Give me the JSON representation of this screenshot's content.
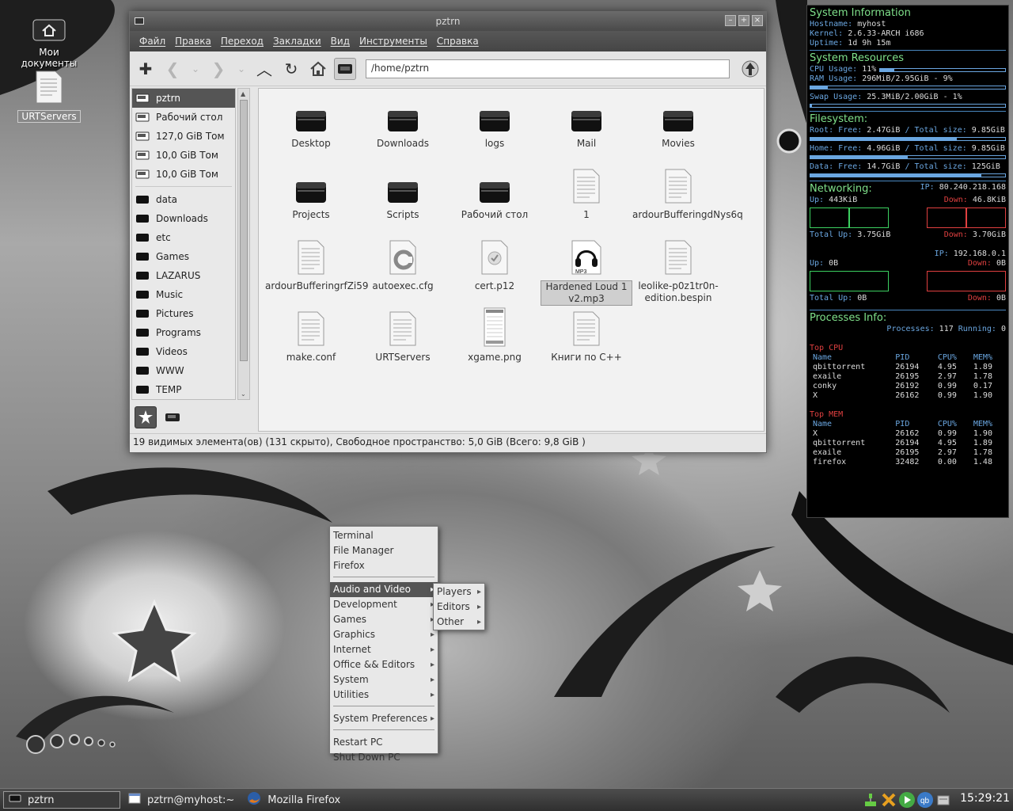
{
  "desktop": {
    "icons": [
      {
        "label": "Мои документы"
      },
      {
        "label": "URTServers"
      }
    ]
  },
  "window": {
    "title": "pztrn",
    "menu": [
      "Файл",
      "Правка",
      "Переход",
      "Закладки",
      "Вид",
      "Инструменты",
      "Справка"
    ],
    "path": "/home/pztrn",
    "sidebar": {
      "devices": [
        "pztrn",
        "Рабочий стол",
        "127,0 GiB Том",
        "10,0 GiB Том",
        "10,0 GiB Том"
      ],
      "bookmarks": [
        "data",
        "Downloads",
        "etc",
        "Games",
        "LAZARUS",
        "Music",
        "Pictures",
        "Programs",
        "Videos",
        "WWW",
        "TEMP"
      ]
    },
    "files": [
      {
        "name": "Desktop",
        "kind": "folder"
      },
      {
        "name": "Downloads",
        "kind": "folder"
      },
      {
        "name": "logs",
        "kind": "folder"
      },
      {
        "name": "Mail",
        "kind": "folder"
      },
      {
        "name": "Movies",
        "kind": "folder"
      },
      {
        "name": "Projects",
        "kind": "folder"
      },
      {
        "name": "Scripts",
        "kind": "folder"
      },
      {
        "name": "Рабочий стол",
        "kind": "folder"
      },
      {
        "name": "1",
        "kind": "doc"
      },
      {
        "name": "ardourBufferingdNys6q",
        "kind": "doc"
      },
      {
        "name": "ardourBufferingrfZi59",
        "kind": "doc"
      },
      {
        "name": "autoexec.cfg",
        "kind": "cfg"
      },
      {
        "name": "cert.p12",
        "kind": "cert"
      },
      {
        "name": "Hardened Loud 1 v2.mp3",
        "kind": "mp3",
        "selected": true
      },
      {
        "name": "leolike-p0z1tr0n-edition.bespin",
        "kind": "doc"
      },
      {
        "name": "make.conf",
        "kind": "doc"
      },
      {
        "name": "URTServers",
        "kind": "doc"
      },
      {
        "name": "xgame.png",
        "kind": "png"
      },
      {
        "name": "Книги по C++",
        "kind": "doc"
      }
    ],
    "status": "19 видимых элемента(ов) (131 скрыто), Свободное пространство: 5,0 GiB (Всего: 9,8 GiB )"
  },
  "conky": {
    "sysinfo_title": "System Information",
    "hostname_label": "Hostname:",
    "hostname": "myhost",
    "kernel_label": "Kernel:",
    "kernel": "2.6.33-ARCH i686",
    "uptime_label": "Uptime:",
    "uptime": "1d 9h 15m",
    "resources_title": "System Resources",
    "cpu_label": "CPU Usage:",
    "cpu": "11%",
    "cpu_frac": 0.11,
    "ram_label": "RAM Usage:",
    "ram": "296MiB/2.95GiB - 9%",
    "ram_frac": 0.09,
    "swap_label": "Swap Usage:",
    "swap": "25.3MiB/2.00GiB - 1%",
    "swap_frac": 0.01,
    "fs_title": "Filesystem:",
    "fs": [
      {
        "label": "Root:",
        "free": "2.47GiB",
        "total": "9.85GiB",
        "frac": 0.75
      },
      {
        "label": "Home:",
        "free": "4.96GiB",
        "total": "9.85GiB",
        "frac": 0.5
      },
      {
        "label": "Data:",
        "free": "14.7GiB",
        "total": "125GiB",
        "frac": 0.88
      }
    ],
    "free_label": "Free:",
    "total_size_label": "/ Total size:",
    "net_title": "Networking:",
    "ip_label": "IP:",
    "ip1": "80.240.218.168",
    "up1": "443KiB",
    "down1": "46.8KiB",
    "total_up1": "3.75GiB",
    "total_down1": "3.70GiB",
    "ip2": "192.168.0.1",
    "up2": "0B",
    "down2": "0B",
    "total_up2": "0B",
    "total_down2": "0B",
    "up_label": "Up:",
    "down_label": "Down:",
    "total_up_label": "Total Up:",
    "proc_title": "Processes Info:",
    "processes_label": "Processes:",
    "processes": "117",
    "running_label": "Running:",
    "running": "0",
    "top_cpu_label": "Top CPU",
    "top_mem_label": "Top MEM",
    "cols": [
      "Name",
      "PID",
      "CPU%",
      "MEM%"
    ],
    "top_cpu": [
      [
        "qbittorrent",
        "26194",
        "4.95",
        "1.89"
      ],
      [
        "exaile",
        "26195",
        "2.97",
        "1.78"
      ],
      [
        "conky",
        "26192",
        "0.99",
        "0.17"
      ],
      [
        "X",
        "26162",
        "0.99",
        "1.90"
      ]
    ],
    "top_mem": [
      [
        "X",
        "26162",
        "0.99",
        "1.90"
      ],
      [
        "qbittorrent",
        "26194",
        "4.95",
        "1.89"
      ],
      [
        "exaile",
        "26195",
        "2.97",
        "1.78"
      ],
      [
        "firefox",
        "32482",
        "0.00",
        "1.48"
      ]
    ]
  },
  "menu": {
    "items": [
      {
        "label": "Terminal"
      },
      {
        "label": "File Manager"
      },
      {
        "label": "Firefox"
      },
      {
        "sep": true
      },
      {
        "label": "Audio and Video",
        "sub": true,
        "hl": true
      },
      {
        "label": "Development",
        "sub": true
      },
      {
        "label": "Games",
        "sub": true
      },
      {
        "label": "Graphics",
        "sub": true
      },
      {
        "label": "Internet",
        "sub": true
      },
      {
        "label": "Office && Editors",
        "sub": true
      },
      {
        "label": "System",
        "sub": true
      },
      {
        "label": "Utilities",
        "sub": true
      },
      {
        "sep": true
      },
      {
        "label": "System Preferences",
        "sub": true
      },
      {
        "sep": true
      },
      {
        "label": "Restart PC"
      },
      {
        "label": "Shut Down PC"
      }
    ],
    "submenu": [
      "Players",
      "Editors",
      "Other"
    ]
  },
  "taskbar": {
    "tasks": [
      {
        "label": "pztrn",
        "active": true
      },
      {
        "label": "pztrn@myhost:~"
      },
      {
        "label": "Mozilla Firefox"
      }
    ],
    "clock": "15:29:21"
  }
}
